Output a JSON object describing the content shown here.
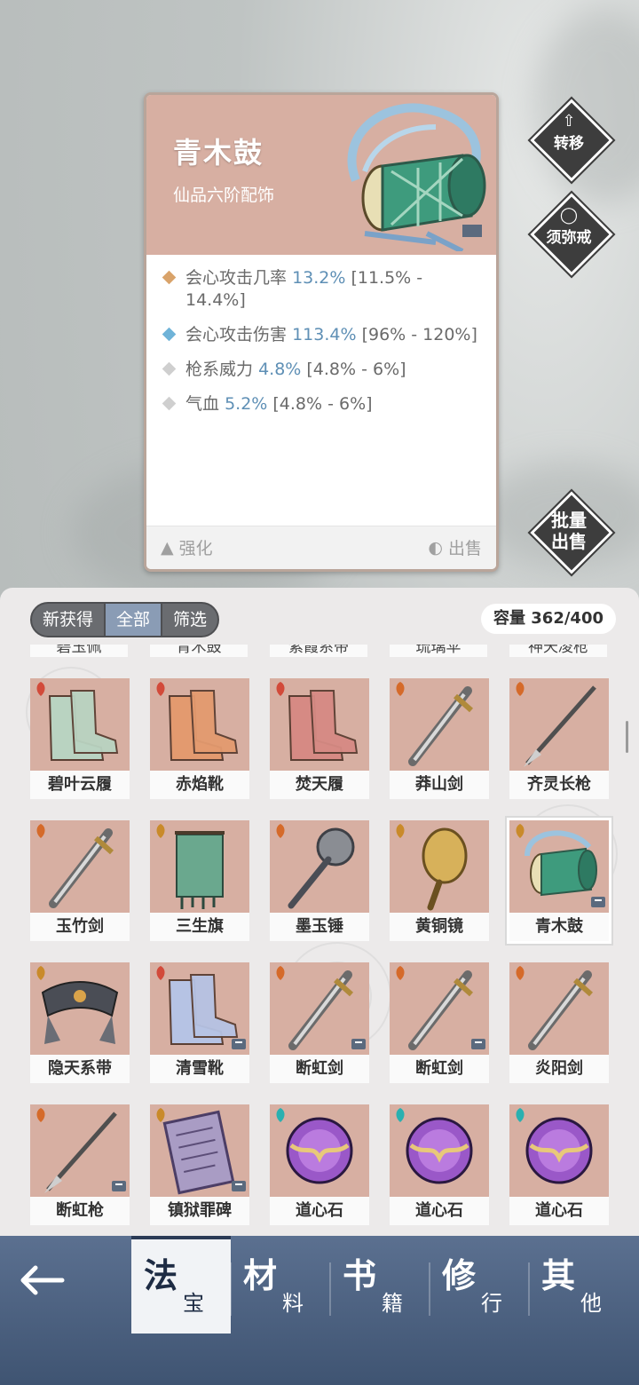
{
  "detail": {
    "name": "青木鼓",
    "grade": "仙品六阶配饰",
    "stats": [
      {
        "label": "会心攻击几率",
        "value": "13.2%",
        "range": "[11.5% - 14.4%]",
        "color": "#d9a36a"
      },
      {
        "label": "会心攻击伤害",
        "value": "113.4%",
        "range": "[96% - 120%]",
        "color": "#6fb3d8"
      },
      {
        "label": "枪系威力",
        "value": "4.8%",
        "range": "[4.8% - 6%]",
        "color": "#cfcfcf"
      },
      {
        "label": "气血",
        "value": "5.2%",
        "range": "[4.8% - 6%]",
        "color": "#cfcfcf"
      }
    ],
    "enhance_label": "强化",
    "sell_label": "出售"
  },
  "side_buttons": {
    "transfer": "转移",
    "sumeru": "须弥戒",
    "batch_sell_1": "批量",
    "batch_sell_2": "出售"
  },
  "inventory": {
    "filters": [
      "新获得",
      "全部",
      "筛选"
    ],
    "active_filter": "全部",
    "capacity": "容量 362/400",
    "cut_row": [
      "碧玉佩",
      "青木鼓",
      "紫霞系带",
      "琉璃伞",
      "神天凌枪"
    ],
    "items": [
      {
        "name": "碧叶云履",
        "type": "boots",
        "badge": "boots",
        "locked": false
      },
      {
        "name": "赤焰靴",
        "type": "boots",
        "badge": "boots",
        "locked": false
      },
      {
        "name": "焚天履",
        "type": "boots",
        "badge": "boots",
        "locked": false
      },
      {
        "name": "莽山剑",
        "type": "sword",
        "badge": "weapon",
        "locked": false
      },
      {
        "name": "齐灵长枪",
        "type": "spear",
        "badge": "weapon",
        "locked": false
      },
      {
        "name": "玉竹剑",
        "type": "sword",
        "badge": "weapon",
        "locked": false
      },
      {
        "name": "三生旗",
        "type": "banner",
        "badge": "accessory",
        "locked": false
      },
      {
        "name": "墨玉锤",
        "type": "hammer",
        "badge": "weapon",
        "locked": false
      },
      {
        "name": "黄铜镜",
        "type": "mirror",
        "badge": "accessory",
        "locked": false
      },
      {
        "name": "青木鼓",
        "type": "drum",
        "badge": "accessory",
        "locked": true
      },
      {
        "name": "隐天系带",
        "type": "belt",
        "badge": "armor",
        "locked": false
      },
      {
        "name": "清雪靴",
        "type": "boots",
        "badge": "boots",
        "locked": true
      },
      {
        "name": "断虹剑",
        "type": "sword",
        "badge": "weapon",
        "locked": true
      },
      {
        "name": "断虹剑",
        "type": "sword",
        "badge": "weapon",
        "locked": true
      },
      {
        "name": "炎阳剑",
        "type": "sword",
        "badge": "weapon",
        "locked": false
      },
      {
        "name": "断虹枪",
        "type": "spear",
        "badge": "weapon",
        "locked": true
      },
      {
        "name": "镇狱罪碑",
        "type": "tablet",
        "badge": "accessory",
        "locked": true
      },
      {
        "name": "道心石",
        "type": "orb",
        "badge": "ring",
        "locked": false
      },
      {
        "name": "道心石",
        "type": "orb",
        "badge": "ring",
        "locked": false
      },
      {
        "name": "道心石",
        "type": "orb",
        "badge": "ring",
        "locked": false
      }
    ],
    "selected_index": 9
  },
  "nav": {
    "tabs": [
      {
        "big": "法",
        "small": "宝"
      },
      {
        "big": "材",
        "small": "料"
      },
      {
        "big": "书",
        "small": "籍"
      },
      {
        "big": "修",
        "small": "行"
      },
      {
        "big": "其",
        "small": "他"
      }
    ],
    "active_tab": 0
  },
  "colors": {
    "card_head": "#d7afa2",
    "stat_value": "#5e8fb5",
    "nav": "#4a5f7f"
  }
}
